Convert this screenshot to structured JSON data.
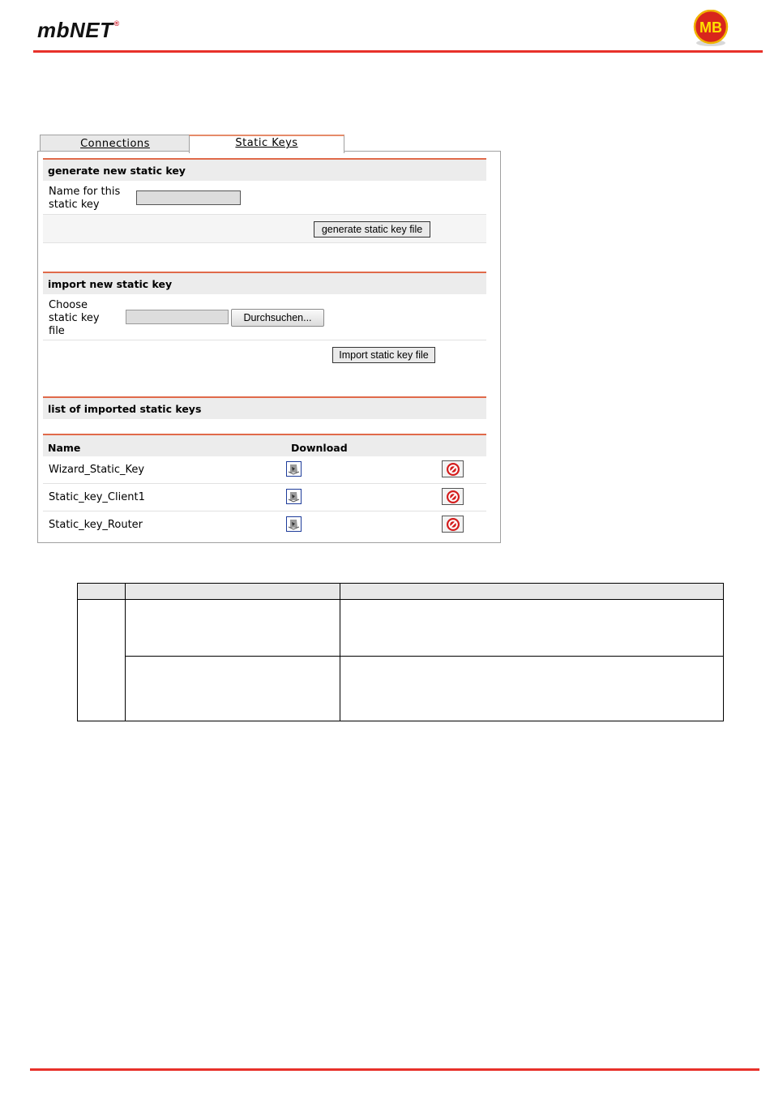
{
  "header": {
    "logo_text": "mbNET",
    "logo_mark": "®",
    "brand_badge": "MB"
  },
  "tabs": [
    {
      "label": "Connections",
      "active": false
    },
    {
      "label": "Static Keys",
      "active": true
    }
  ],
  "generate": {
    "title": "generate new static key",
    "name_label_line1": "Name for this",
    "name_label_line2": "static key",
    "name_value": "",
    "button_label": "generate static key file"
  },
  "import": {
    "title": "import new static key",
    "choose_line1": "Choose",
    "choose_line2": "static key",
    "choose_line3": "file",
    "file_value": "",
    "browse_label": "Durchsuchen...",
    "button_label": "Import static key file"
  },
  "list": {
    "title": "list of imported static keys",
    "col_name": "Name",
    "col_download": "Download",
    "rows": [
      {
        "name": "Wizard_Static_Key",
        "download_icon": "download-icon",
        "delete_icon": "delete-icon"
      },
      {
        "name": "Static_key_Client1",
        "download_icon": "download-icon",
        "delete_icon": "delete-icon"
      },
      {
        "name": "Static_key_Router",
        "download_icon": "download-icon",
        "delete_icon": "delete-icon"
      }
    ]
  },
  "colors": {
    "accent_red": "#e8312a",
    "header_grey": "#ececec"
  }
}
